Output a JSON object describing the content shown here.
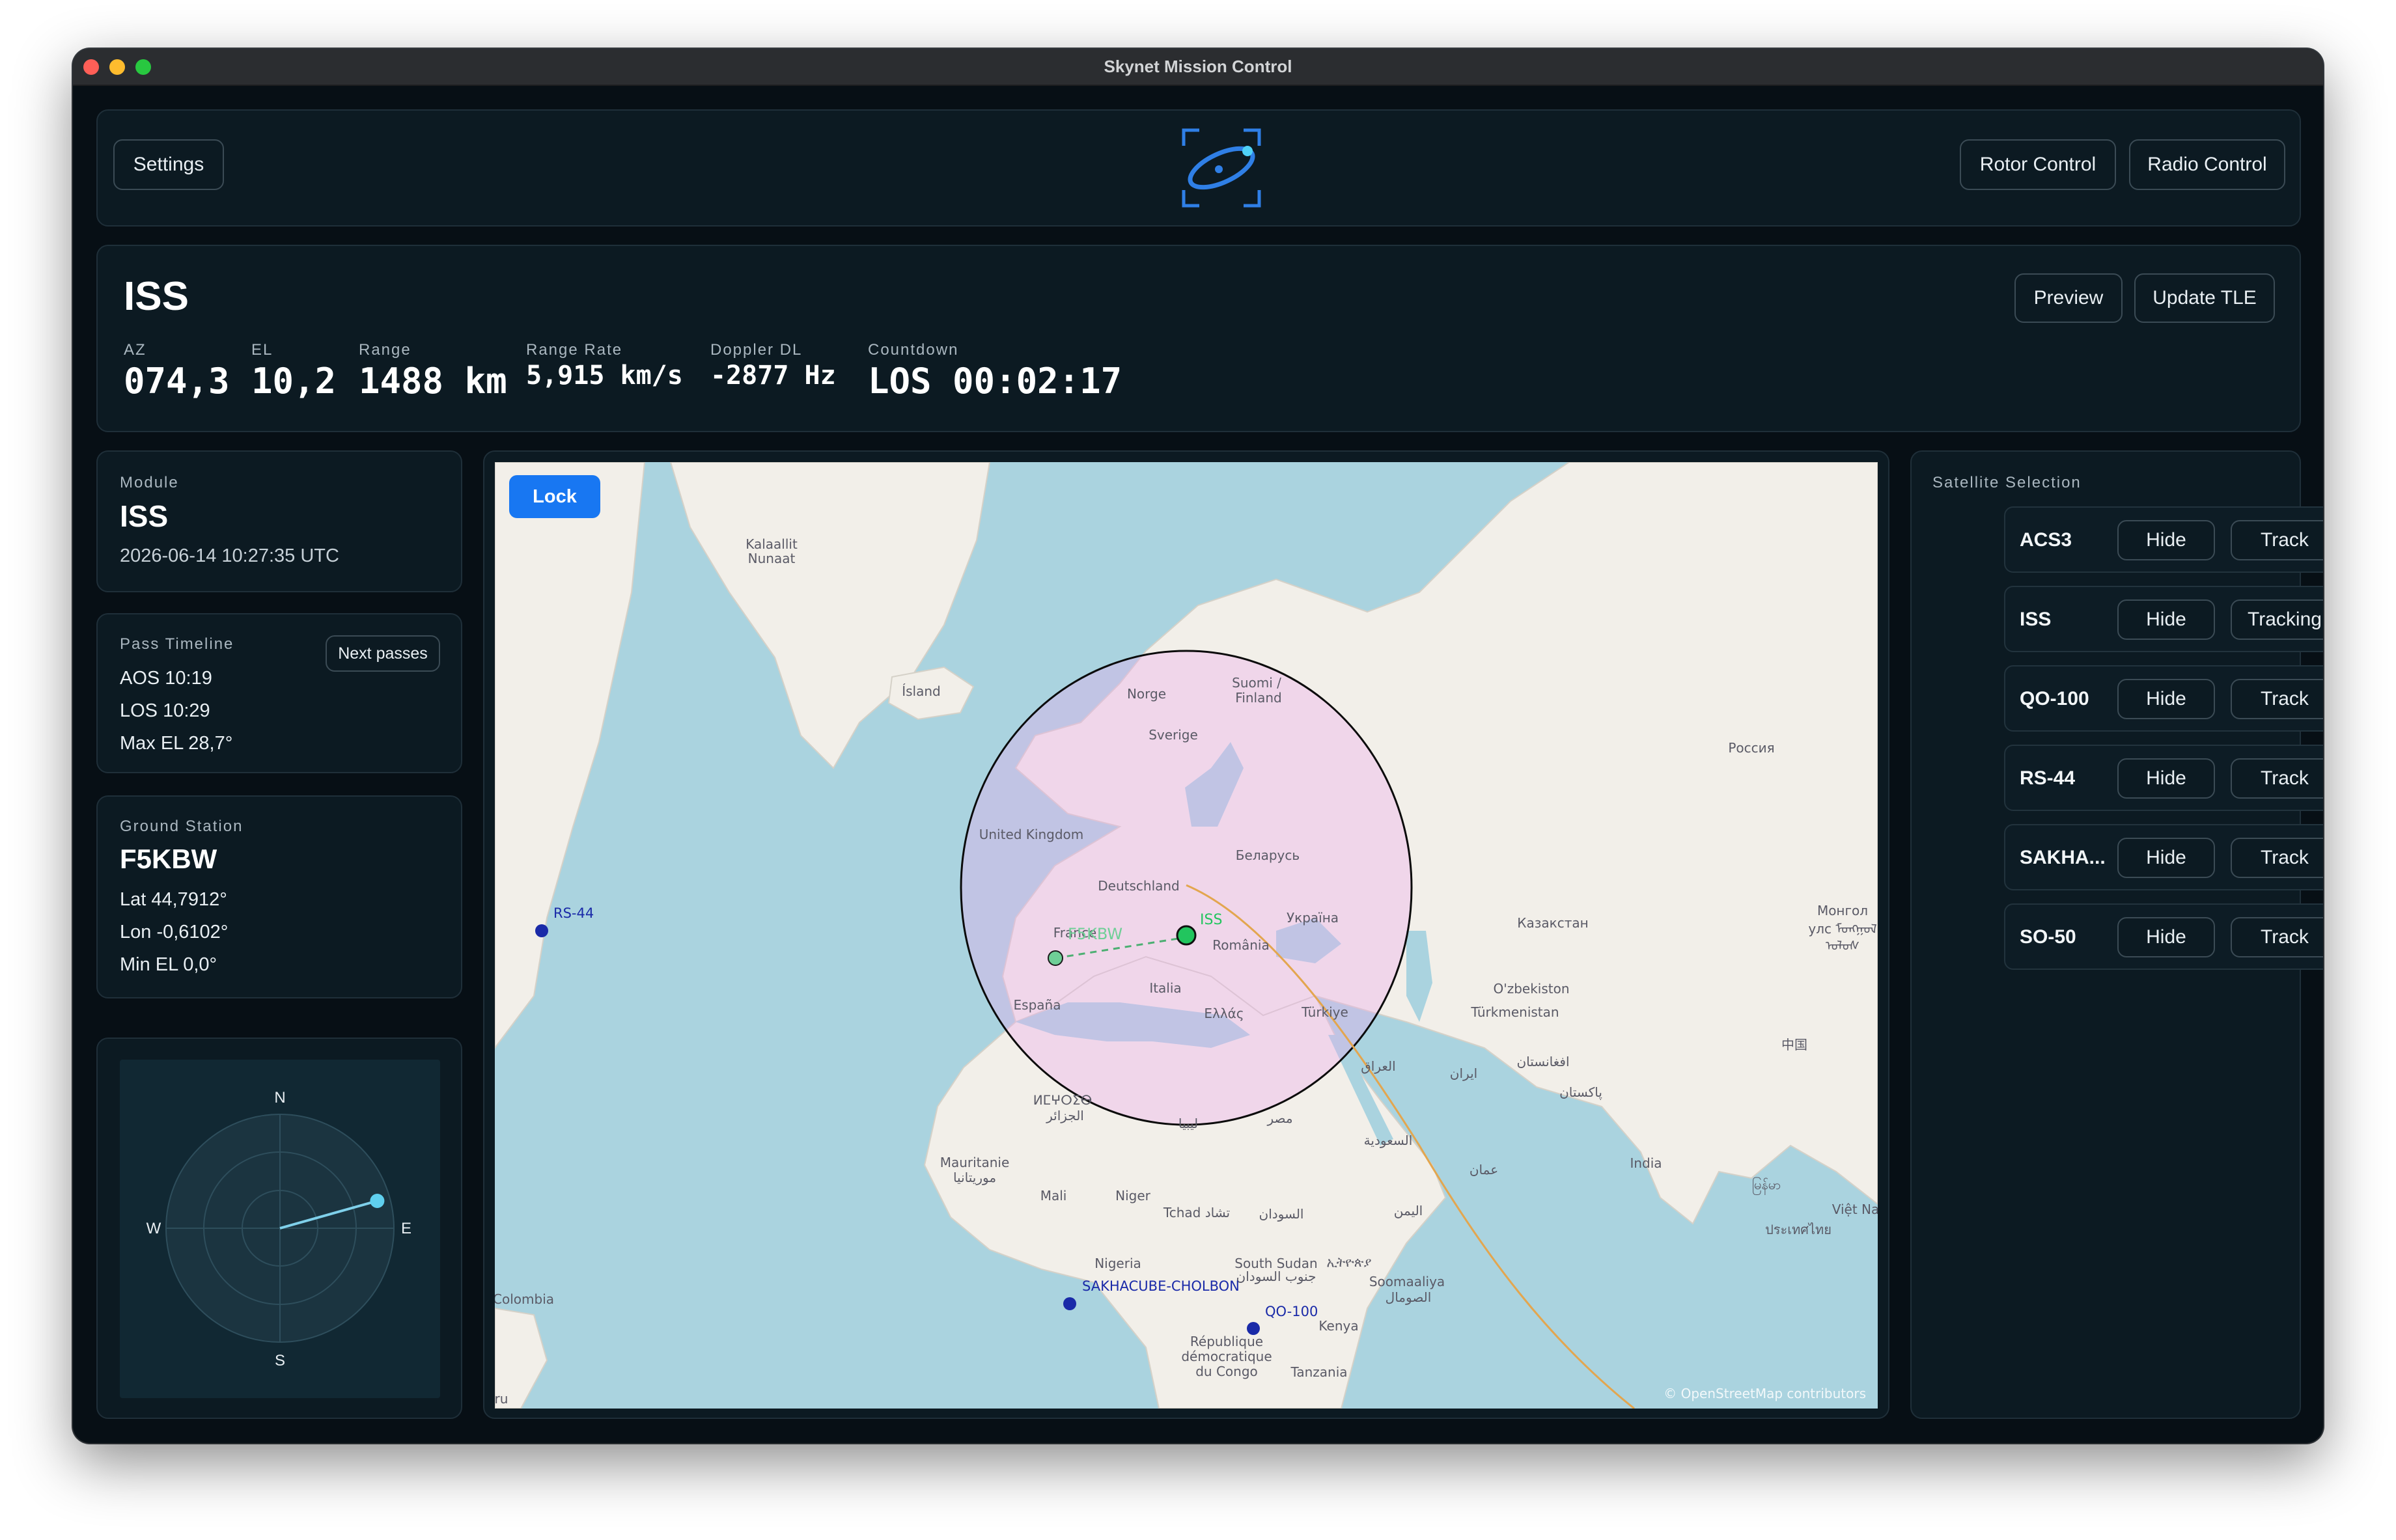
{
  "window": {
    "title": "Skynet Mission Control"
  },
  "header": {
    "settings_label": "Settings",
    "logo_icon": "satellite-orbit-logo-icon",
    "rotor_label": "Rotor Control",
    "radio_label": "Radio Control"
  },
  "satellite_info": {
    "name": "ISS",
    "preview_label": "Preview",
    "update_tle_label": "Update TLE",
    "stats": [
      {
        "label": "AZ",
        "value": "074,3"
      },
      {
        "label": "EL",
        "value": "10,2"
      },
      {
        "label": "Range",
        "value": "1488 km"
      },
      {
        "label": "Range Rate",
        "value": "5,915 km/s"
      },
      {
        "label": "Doppler DL",
        "value": "-2877 Hz"
      },
      {
        "label": "Countdown",
        "value": "LOS 00:02:17"
      }
    ]
  },
  "module": {
    "label": "Module",
    "name": "ISS",
    "timestamp": "2026-06-14 10:27:35 UTC"
  },
  "pass_timeline": {
    "label": "Pass Timeline",
    "next_passes_label": "Next passes",
    "aos": "AOS 10:19",
    "los": "LOS 10:29",
    "max_el": "Max EL 28,7°"
  },
  "ground_station": {
    "label": "Ground Station",
    "name": "F5KBW",
    "lat": "Lat 44,7912°",
    "lon": "Lon -0,6102°",
    "min_el": "Min EL 0,0°"
  },
  "polar_plot": {
    "north": "N",
    "east": "E",
    "south": "S",
    "west": "W",
    "azimuth_deg": 74.3,
    "elevation_deg": 10.2
  },
  "map": {
    "lock_label": "Lock",
    "attribution": "© OpenStreetMap contributors",
    "station_label": "F5KBW",
    "satellites": [
      {
        "label": "ISS",
        "color": "#22c55e"
      },
      {
        "label": "RS-44",
        "color": "#1a2aa8"
      },
      {
        "label": "SAKHACUBE-CHOLBON",
        "color": "#1a2aa8"
      },
      {
        "label": "QO-100",
        "color": "#1a2aa8"
      }
    ],
    "place_names": {
      "kalaallit": "Kalaallit",
      "nunaat": "Nunaat",
      "island": "Ísland",
      "norge": "Norge",
      "sverige": "Sverige",
      "suomi": "Suomi /",
      "finland": "Finland",
      "russia": "Россия",
      "uk": "United Kingdom",
      "belarus": "Беларусь",
      "deutschland": "Deutschland",
      "france": "France",
      "ukraina": "Україна",
      "romania": "România",
      "kazakhstan": "Казакстан",
      "mongolia1": "Монгол",
      "mongolia2": "улс ᠮᠣᠩᠭᠣᠯ",
      "mongolia3": "ᠤᠯᠤᠰ",
      "espana": "España",
      "italia": "Italia",
      "ellas": "Ελλάς",
      "turkiye": "Türkiye",
      "uzbekistan": "O'zbekiston",
      "turkmenistan": "Türkmenistan",
      "afghanistan": "افغانستان",
      "iraq": "العراق",
      "iran": "ایران",
      "pakistan": "پاکستان",
      "china": "中国",
      "morocco1": "ⵍⵎⵖⵔⵉⴱ",
      "morocco2": "الجزائر",
      "libya": "ليبيا",
      "egypt": "مصر",
      "saudi": "السعودية",
      "oman": "عمان",
      "india": "India",
      "mauritanie": "Mauritanie",
      "mauritanie_ar": "موريتانيا",
      "mali": "Mali",
      "niger": "Niger",
      "tchad": "Tchad تشاد",
      "sudan": "السودان",
      "yemen": "اليمن",
      "myanmar": "မြန်မာ",
      "vietnam": "Việt Na",
      "thailand": "ประเทศไทย",
      "nigeria": "Nigeria",
      "south_sudan": "South Sudan",
      "ethiopia": "ኢትዮጵያ",
      "south_sudan_ar": "جنوب السودان",
      "somalia": "Soomaaliya",
      "somalia_ar": "الصومال",
      "colombia": "Colombia",
      "rdc1": "République",
      "rdc2": "démocratique",
      "rdc3": "du Congo",
      "kenya": "Kenya",
      "tanzania": "Tanzania",
      "ru": "ru"
    }
  },
  "satellite_selection": {
    "label": "Satellite Selection",
    "hide_label": "Hide",
    "rows": [
      {
        "name": "ACS3",
        "track_label": "Track"
      },
      {
        "name": "ISS",
        "track_label": "Tracking"
      },
      {
        "name": "QO-100",
        "track_label": "Track"
      },
      {
        "name": "RS-44",
        "track_label": "Track"
      },
      {
        "name": "SAKHA...",
        "track_label": "Track"
      },
      {
        "name": "SO-50",
        "track_label": "Track"
      }
    ]
  }
}
